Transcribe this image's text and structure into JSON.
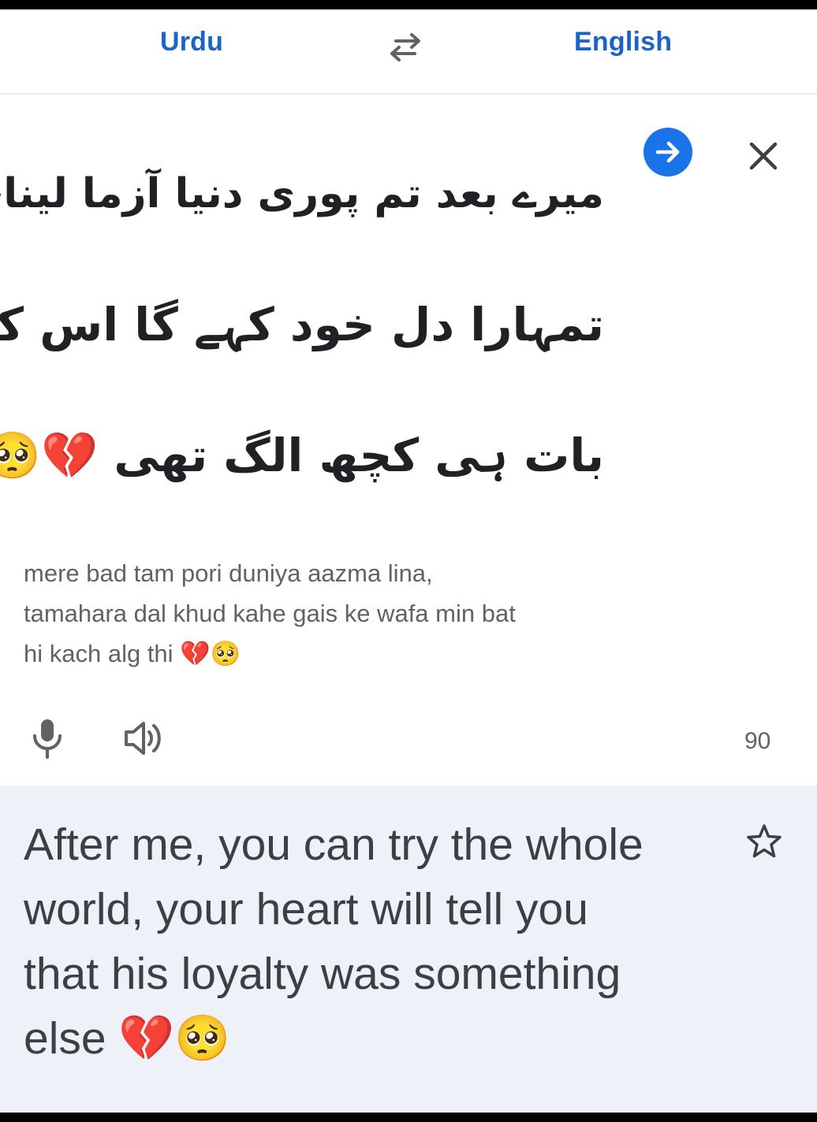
{
  "header": {
    "source_language": "Urdu",
    "target_language": "English",
    "swap_icon": "swap-arrows-icon"
  },
  "input": {
    "urdu_lines": [
      "میرے بعد تم پوری دنیا آزما لینا،",
      "تمہارا دل خود کہے گا اس کے وفا میں",
      "بات ہی کچھ الگ تھی 💔🥺"
    ],
    "transliteration_lines": [
      "mere bad tam pori duniya aazma lina,",
      "tamahara dal khud kahe gais ke wafa min bat",
      "hi kach alg thi 💔🥺"
    ],
    "char_count": "90",
    "icons": {
      "translate": "arrow-forward-icon",
      "clear": "close-icon",
      "mic": "microphone-icon",
      "listen": "speaker-icon"
    }
  },
  "output": {
    "translation_lines": [
      "After me, you can try the whole",
      "world, your heart will tell you",
      "that his loyalty was something",
      "else 💔🥺"
    ],
    "icons": {
      "save": "star-outline-icon"
    }
  },
  "colors": {
    "accent": "#1a73e8",
    "language_label": "#1a64c8",
    "output_background": "#eef1f7"
  }
}
